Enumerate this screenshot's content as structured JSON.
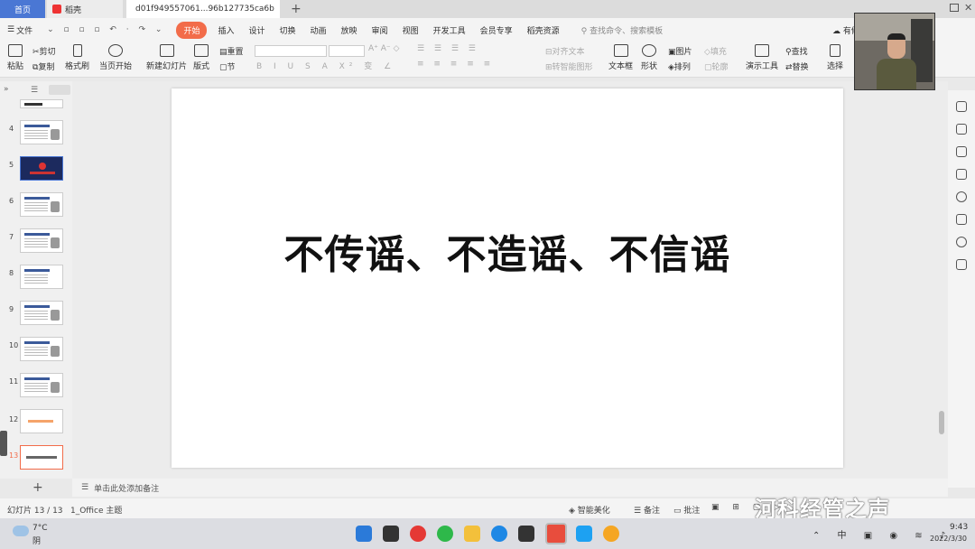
{
  "tabs": [
    {
      "label": "首页"
    },
    {
      "label": "稻壳"
    },
    {
      "label": "d01f949557061...96b127735ca6b"
    }
  ],
  "new_tab_symbol": "+",
  "menu": {
    "file": "文件",
    "start": "开始",
    "items": [
      "插入",
      "设计",
      "切换",
      "动画",
      "放映",
      "审阅",
      "视图",
      "开发工具",
      "会员专享",
      "稻壳资源"
    ],
    "search_placeholder": "查找命令、搜索模板",
    "right_label": "有修"
  },
  "ribbon": {
    "paste": "粘贴",
    "cut": "剪切",
    "copy": "复制",
    "format_painter": "格式刷",
    "from_current": "当页开始",
    "new_slide": "新建幻灯片",
    "layout": "版式",
    "reset": "重置",
    "section": "节",
    "align_text": "对齐文本",
    "smart_graphic": "转智能图形",
    "text_box": "文本框",
    "shape": "形状",
    "picture": "图片",
    "arrange": "排列",
    "fill": "填充",
    "outline": "轮廓",
    "presentation_tools": "演示工具",
    "find": "查找",
    "replace": "替换",
    "select": "选择"
  },
  "slides": [
    {
      "num": "4"
    },
    {
      "num": "5"
    },
    {
      "num": "6"
    },
    {
      "num": "7"
    },
    {
      "num": "8"
    },
    {
      "num": "9"
    },
    {
      "num": "10"
    },
    {
      "num": "11"
    },
    {
      "num": "12"
    },
    {
      "num": "13"
    }
  ],
  "slide": {
    "title": "不传谣、不造谣、不信谣"
  },
  "notes_placeholder": "单击此处添加备注",
  "status": {
    "slide_count": "幻灯片 13 / 13",
    "theme": "1_Office 主题",
    "smart_beautify": "智能美化",
    "notes": "备注",
    "comments": "批注"
  },
  "weather": {
    "temp": "7°C",
    "desc": "阴"
  },
  "clock": {
    "time": "9:43",
    "date": "2022/3/30"
  },
  "watermark": "河科经管之声",
  "colors": {
    "accent": "#f26c4a",
    "tab_home": "#4a77d4"
  }
}
